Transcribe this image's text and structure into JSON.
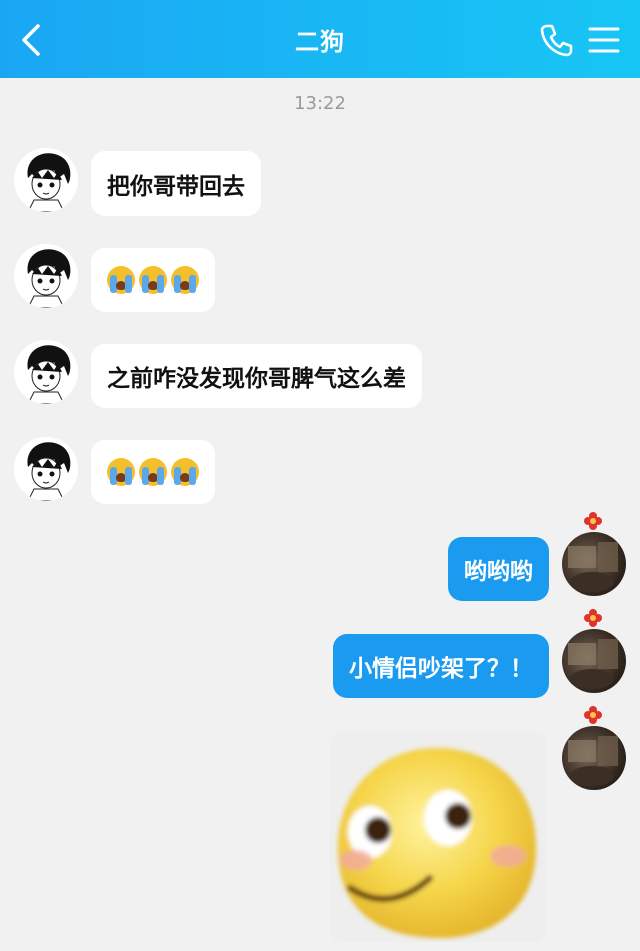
{
  "header": {
    "back_icon": "chevron-left-icon",
    "title": "二狗",
    "call_icon": "phone-icon",
    "menu_icon": "menu-icon"
  },
  "timestamp": "13:22",
  "messages": [
    {
      "side": "left",
      "type": "text",
      "text": "把你哥带回去"
    },
    {
      "side": "left",
      "type": "emoji",
      "emoji": [
        "loudly-crying-face",
        "loudly-crying-face",
        "loudly-crying-face"
      ]
    },
    {
      "side": "left",
      "type": "text",
      "text": "之前咋没发现你哥脾气这么差"
    },
    {
      "side": "left",
      "type": "emoji",
      "emoji": [
        "loudly-crying-face",
        "loudly-crying-face",
        "loudly-crying-face"
      ]
    },
    {
      "side": "right",
      "type": "text",
      "text": "哟哟哟"
    },
    {
      "side": "right",
      "type": "text",
      "text": "小情侣吵架了？！"
    },
    {
      "side": "right",
      "type": "sticker",
      "sticker": "smirking-yellow-face-sticker"
    }
  ],
  "colors": {
    "header_start": "#1aa6f3",
    "header_end": "#17c6f4",
    "outgoing_bubble": "#1a9bf0",
    "incoming_bubble": "#ffffff",
    "background": "#f1f1f1"
  }
}
